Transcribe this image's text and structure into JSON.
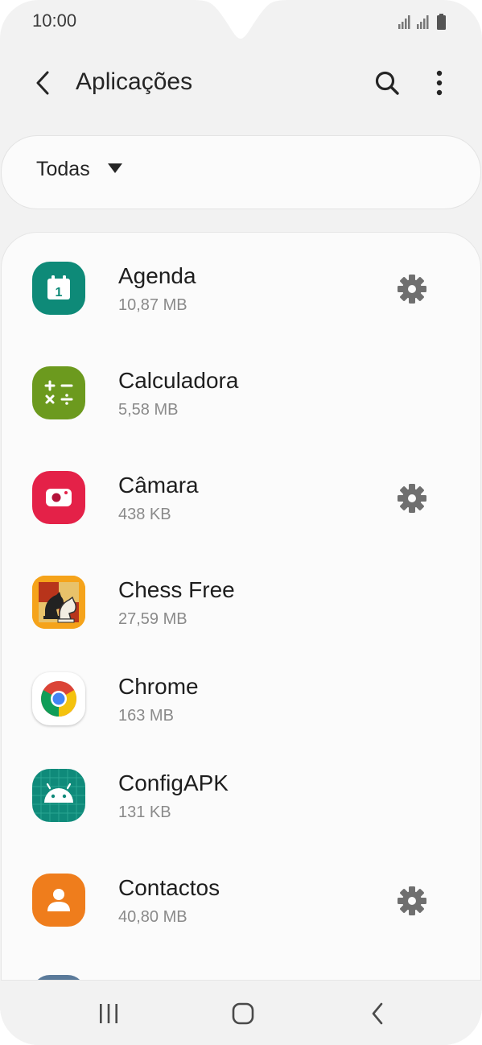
{
  "status_bar": {
    "time": "10:00",
    "icons": [
      "signal-icon",
      "signal-icon",
      "battery-icon"
    ]
  },
  "app_bar": {
    "title": "Aplicações",
    "back_icon": "back-arrow-icon",
    "search_icon": "search-icon",
    "more_icon": "more-vert-icon"
  },
  "filter": {
    "label": "Todas",
    "icon": "dropdown-arrow-icon"
  },
  "apps": [
    {
      "name": "Agenda",
      "size": "10,87 MB",
      "icon": "calendar-icon",
      "color": "#0e8a78",
      "has_settings": true
    },
    {
      "name": "Calculadora",
      "size": "5,58 MB",
      "icon": "calculator-icon",
      "color": "#6c9a1e",
      "has_settings": false
    },
    {
      "name": "Câmara",
      "size": "438 KB",
      "icon": "camera-icon",
      "color": "#e42148",
      "has_settings": true
    },
    {
      "name": "Chess Free",
      "size": "27,59 MB",
      "icon": "chess-icon",
      "color": "#f2a00c",
      "has_settings": false
    },
    {
      "name": "Chrome",
      "size": "163 MB",
      "icon": "chrome-icon",
      "color": "#ffffff",
      "has_settings": false
    },
    {
      "name": "ConfigAPK",
      "size": "131 KB",
      "icon": "android-icon",
      "color": "#0f8a7a",
      "has_settings": false
    },
    {
      "name": "Contactos",
      "size": "40,80 MB",
      "icon": "contact-icon",
      "color": "#ef7d1c",
      "has_settings": true
    }
  ],
  "settings_icon": "gear-icon",
  "nav_bar": {
    "recents_icon": "recents-icon",
    "home_icon": "home-icon",
    "back_icon": "nav-back-icon"
  }
}
